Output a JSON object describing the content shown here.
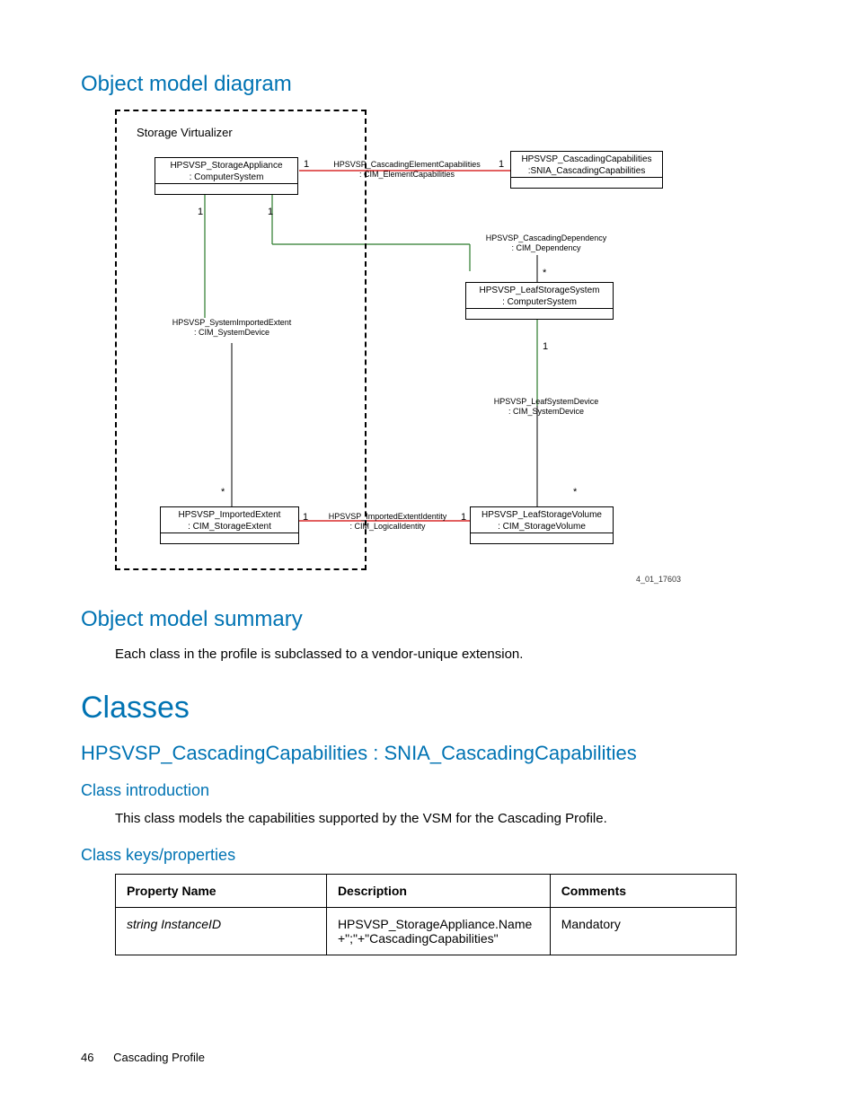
{
  "sections": {
    "diagram_heading": "Object model diagram",
    "summary_heading": "Object model summary",
    "summary_text": "Each class in the profile is subclassed to a vendor-unique extension.",
    "classes_heading": "Classes",
    "class_name": "HPSVSP_CascadingCapabilities : SNIA_CascadingCapabilities",
    "intro_heading": "Class introduction",
    "intro_text": "This class models the capabilities supported by the VSM for the Cascading Profile.",
    "keys_heading": "Class keys/properties"
  },
  "diagram": {
    "virtualizer_label": "Storage Virtualizer",
    "storage_appliance_l1": "HPSVSP_StorageAppliance",
    "storage_appliance_l2": ": ComputerSystem",
    "casc_elem_caps_l1": "HPSVSP_CascadingElementCapabilities",
    "casc_elem_caps_l2": ": CIM_ElementCapabilities",
    "casc_caps_l1": "HPSVSP_CascadingCapabilities",
    "casc_caps_l2": ":SNIA_CascadingCapabilities",
    "casc_dep_l1": "HPSVSP_CascadingDependency",
    "casc_dep_l2": ": CIM_Dependency",
    "leaf_ss_l1": "HPSVSP_LeafStorageSystem",
    "leaf_ss_l2": ": ComputerSystem",
    "sys_imp_ext_l1": "HPSVSP_SystemImportedExtent",
    "sys_imp_ext_l2": ": CIM_SystemDevice",
    "leaf_sd_l1": "HPSVSP_LeafSystemDevice",
    "leaf_sd_l2": ": CIM_SystemDevice",
    "imp_ext_l1": "HPSVSP_ImportedExtent",
    "imp_ext_l2": ": CIM_StorageExtent",
    "imp_ext_id_l1": "HPSVSP_ImportedExtentIdentity",
    "imp_ext_id_l2": ": CIM_LogicalIdentity",
    "leaf_sv_l1": "HPSVSP_LeafStorageVolume",
    "leaf_sv_l2": ": CIM_StorageVolume",
    "mult_1": "1",
    "mult_star": "*",
    "diagram_id": "4_01_17603"
  },
  "table": {
    "headers": [
      "Property Name",
      "Description",
      "Comments"
    ],
    "rows": [
      {
        "name": "string InstanceID",
        "desc": "HPSVSP_StorageAppliance.Name+\";\"+\"CascadingCapabilities\"",
        "comments": "Mandatory"
      }
    ]
  },
  "footer": {
    "page": "46",
    "title": "Cascading Profile"
  }
}
